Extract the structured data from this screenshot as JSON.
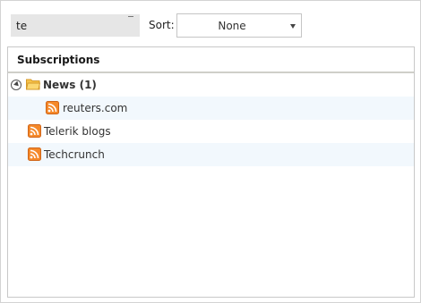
{
  "toolbar": {
    "search": {
      "value": "te",
      "placeholder": ""
    },
    "sort_label": "Sort:",
    "sort_value": "None"
  },
  "panel": {
    "title": "Subscriptions",
    "items": [
      {
        "label": "News (1)",
        "type": "folder",
        "expanded": true
      },
      {
        "label": "reuters.com",
        "type": "feed",
        "level": 1
      },
      {
        "label": "Telerik blogs",
        "type": "feed",
        "level": 0
      },
      {
        "label": "Techcrunch",
        "type": "feed",
        "level": 0
      }
    ]
  },
  "icons": {
    "folder": "folder-icon",
    "feed": "rss-feed-icon",
    "expander": "expand-collapse-icon"
  },
  "colors": {
    "rss_orange": "#f5892a",
    "folder_yellow": "#f6c24a",
    "row_alt": "#f2f8fd"
  }
}
